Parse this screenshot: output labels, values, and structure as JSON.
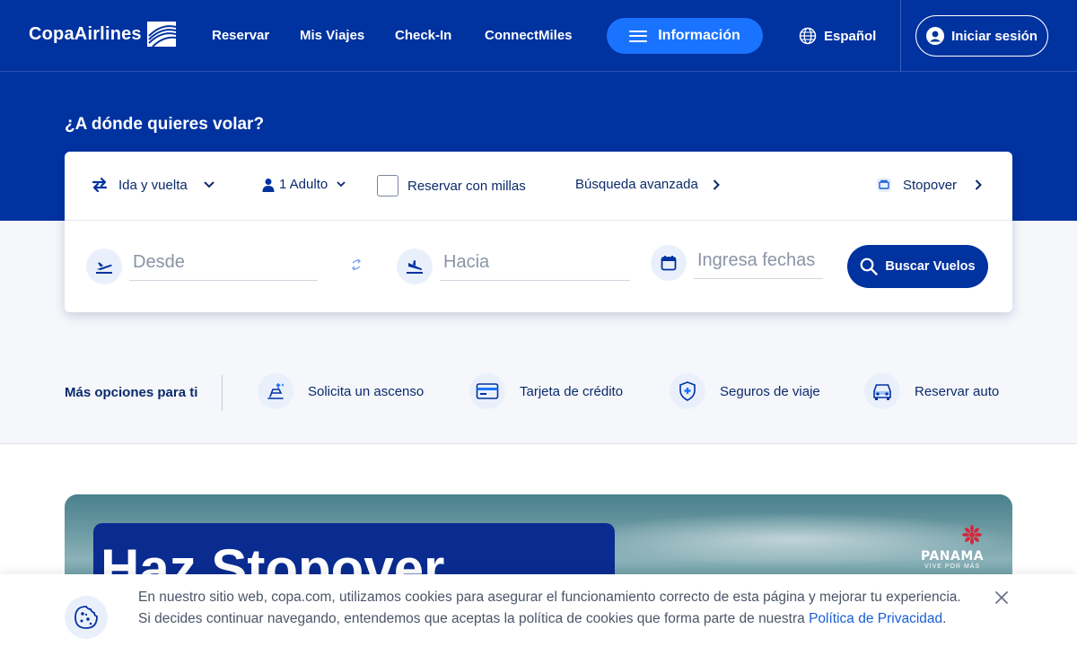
{
  "header": {
    "logo_text": "CopaAirlines",
    "nav": [
      "Reservar",
      "Mis Viajes",
      "Check-In",
      "ConnectMiles"
    ],
    "info_label": "Información",
    "language": "Español",
    "login_label": "Iniciar sesión"
  },
  "hero": {
    "title": "¿A dónde quieres volar?"
  },
  "search": {
    "trip_type": "Ida y vuelta",
    "passengers": "1 Adulto",
    "miles_label": "Reservar con millas",
    "advanced_label": "Búsqueda avanzada",
    "stopover_label": "Stopover",
    "from_placeholder": "Desde",
    "to_placeholder": "Hacia",
    "dates_placeholder": "Ingresa fechas",
    "search_button": "Buscar Vuelos"
  },
  "more_options": {
    "title": "Más opciones para ti",
    "items": [
      "Solicita un ascenso",
      "Tarjeta de crédito",
      "Seguros de viaje",
      "Reservar auto"
    ]
  },
  "promo": {
    "headline": "Haz Stopover",
    "partner_name": "PANAMA",
    "partner_tagline": "VIVE POR MÁS"
  },
  "cookie": {
    "text": "En nuestro sitio web, copa.com, utilizamos cookies para asegurar el funcionamiento correcto de esta página y mejorar tu experiencia. Si decides continuar navegando, entendemos que aceptas la política de cookies que forma parte de nuestra ",
    "link": "Política de Privacidad",
    "suffix": "."
  },
  "colors": {
    "brand_blue": "#0032a0",
    "accent_blue": "#1a73ff",
    "link_blue": "#1a5fd6"
  }
}
